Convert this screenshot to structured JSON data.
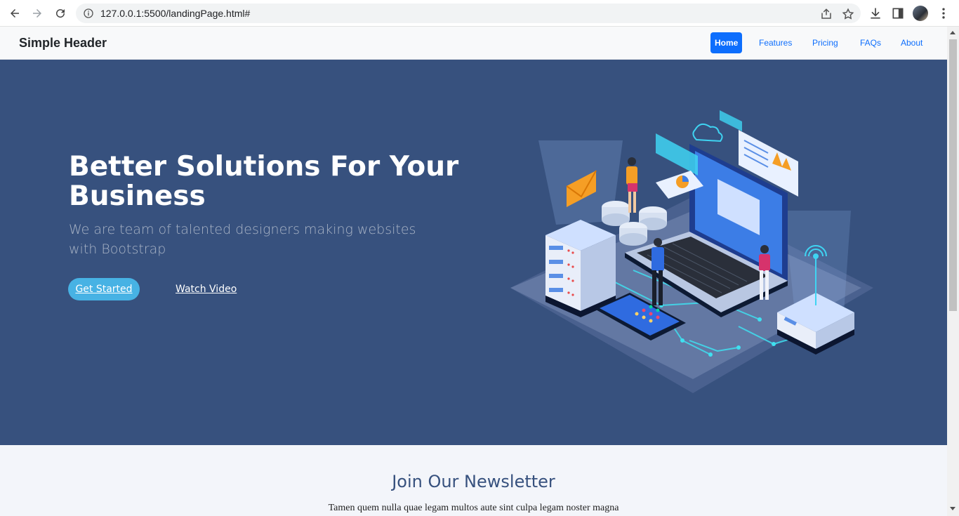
{
  "browser": {
    "url": "127.0.0.1:5500/landingPage.html#"
  },
  "header": {
    "brand": "Simple Header",
    "nav": [
      {
        "label": "Home",
        "active": true
      },
      {
        "label": "Features",
        "active": false
      },
      {
        "label": "Pricing",
        "active": false
      },
      {
        "label": "FAQs",
        "active": false
      },
      {
        "label": "About",
        "active": false
      }
    ]
  },
  "hero": {
    "title": "Better Solutions For Your Business",
    "subtitle": "We are team of talented designers making websites with Bootstrap",
    "primary_button": "Get Started",
    "secondary_button": "Watch Video",
    "illustration": "isometric-tech-illustration"
  },
  "newsletter": {
    "title": "Join Our Newsletter",
    "text": "Tamen quem nulla quae legam multos aute sint culpa legam noster magna"
  },
  "colors": {
    "hero_bg": "#37517e",
    "accent": "#47b2e4",
    "nav_active": "#0d6efd",
    "newsletter_bg": "#f3f5fa"
  }
}
